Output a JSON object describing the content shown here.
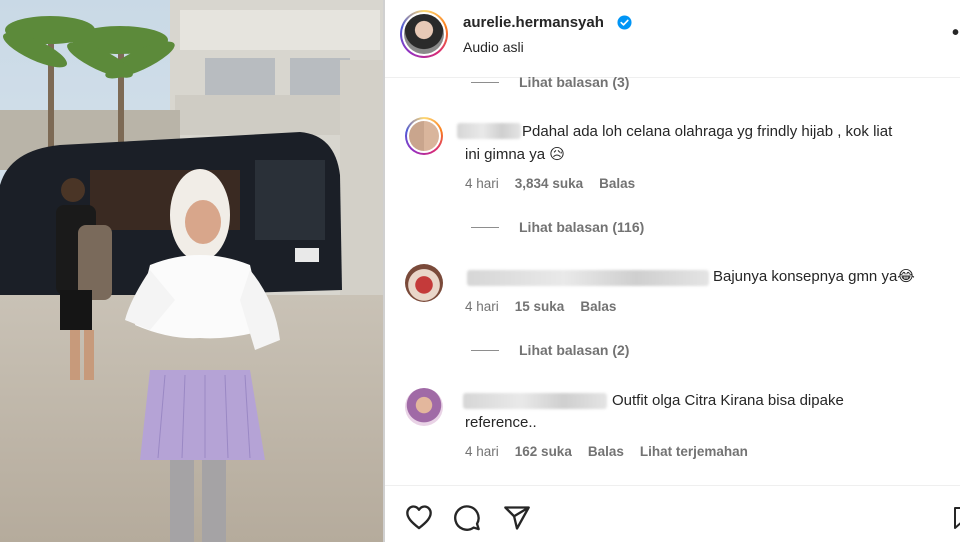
{
  "post": {
    "username": "aurelie.hermansyah",
    "audio": "Audio asli",
    "more_icon": "more-horizontal-icon"
  },
  "comments": [
    {
      "view_replies": "Lihat balasan (3)"
    },
    {
      "text": "Pdahal ada loh celana olahraga yg frindly hijab , kok liat ini gimna ya 😥",
      "line1": "Pdahal ada loh celana olahraga yg frindly hijab , kok liat",
      "line2": "ini gimna ya 😥",
      "time": "4 hari",
      "likes": "3,834 suka",
      "reply": "Balas",
      "view_replies": "Lihat balasan (116)"
    },
    {
      "text": "Bajunya konsepnya gmn ya😂",
      "time": "4 hari",
      "likes": "15 suka",
      "reply": "Balas",
      "view_replies": "Lihat balasan (2)"
    },
    {
      "line1": "Outfit olga Citra Kirana bisa dipake",
      "line2": "reference..",
      "time": "4 hari",
      "likes": "162 suka",
      "reply": "Balas",
      "translate": "Lihat terjemahan"
    }
  ],
  "actions": {
    "like_icon": "heart-icon",
    "comment_icon": "comment-icon",
    "share_icon": "send-icon",
    "save_icon": "bookmark-icon"
  },
  "colors": {
    "verified": "#0095f6",
    "text": "#262626",
    "secondary": "#737373"
  }
}
